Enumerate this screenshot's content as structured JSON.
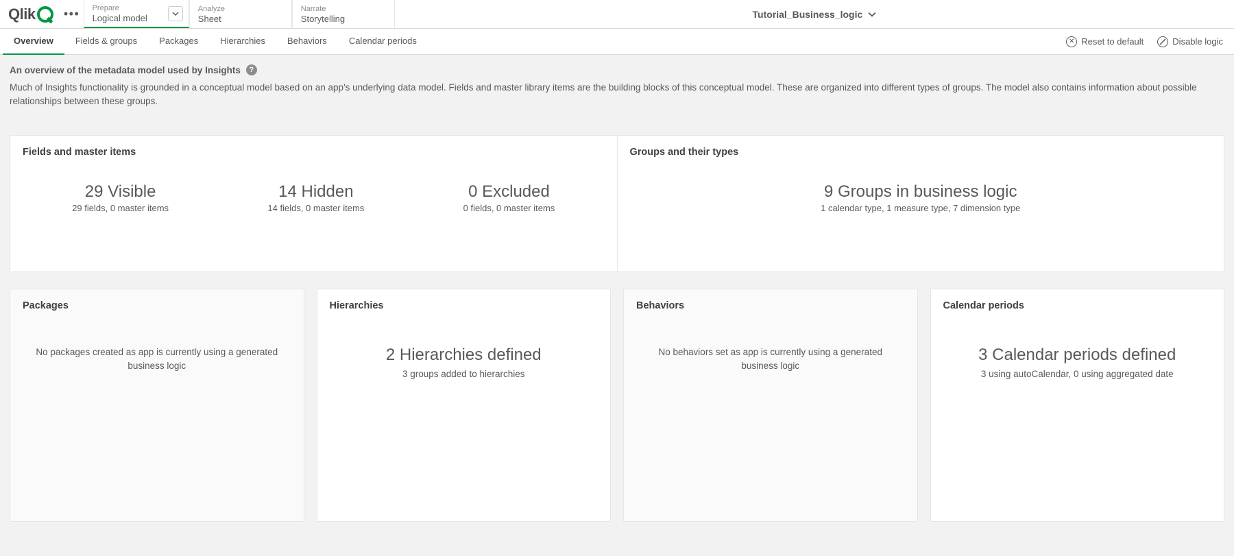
{
  "header": {
    "logo_text": "Qlik",
    "app_title": "Tutorial_Business_logic",
    "nav_prepare_small": "Prepare",
    "nav_prepare_big": "Logical model",
    "nav_analyze_small": "Analyze",
    "nav_analyze_big": "Sheet",
    "nav_narrate_small": "Narrate",
    "nav_narrate_big": "Storytelling"
  },
  "subtabs": {
    "overview": "Overview",
    "fields_groups": "Fields & groups",
    "packages": "Packages",
    "hierarchies": "Hierarchies",
    "behaviors": "Behaviors",
    "calendar_periods": "Calendar periods"
  },
  "subactions": {
    "reset": "Reset to default",
    "disable": "Disable logic"
  },
  "description": {
    "title": "An overview of the metadata model used by Insights",
    "body": "Much of Insights functionality is grounded in a conceptual model based on an app's underlying data model. Fields and master library items are the building blocks of this conceptual model. These are organized into different types of groups. The model also contains information about possible relationships between these groups."
  },
  "row1": {
    "left_title": "Fields and master items",
    "right_title": "Groups and their types",
    "visible_big": "29 Visible",
    "visible_sub": "29 fields, 0 master items",
    "hidden_big": "14 Hidden",
    "hidden_sub": "14 fields, 0 master items",
    "excluded_big": "0 Excluded",
    "excluded_sub": "0 fields, 0 master items",
    "groups_big": "9 Groups in business logic",
    "groups_sub": "1 calendar type, 1 measure type, 7 dimension type"
  },
  "row2": {
    "packages_title": "Packages",
    "packages_body": "No packages created as app is currently using a generated business logic",
    "hierarchies_title": "Hierarchies",
    "hierarchies_big": "2 Hierarchies defined",
    "hierarchies_sub": "3 groups added to hierarchies",
    "behaviors_title": "Behaviors",
    "behaviors_body": "No behaviors set as app is currently using a generated business logic",
    "calendar_title": "Calendar periods",
    "calendar_big": "3 Calendar periods defined",
    "calendar_sub": "3 using autoCalendar, 0 using aggregated date"
  }
}
